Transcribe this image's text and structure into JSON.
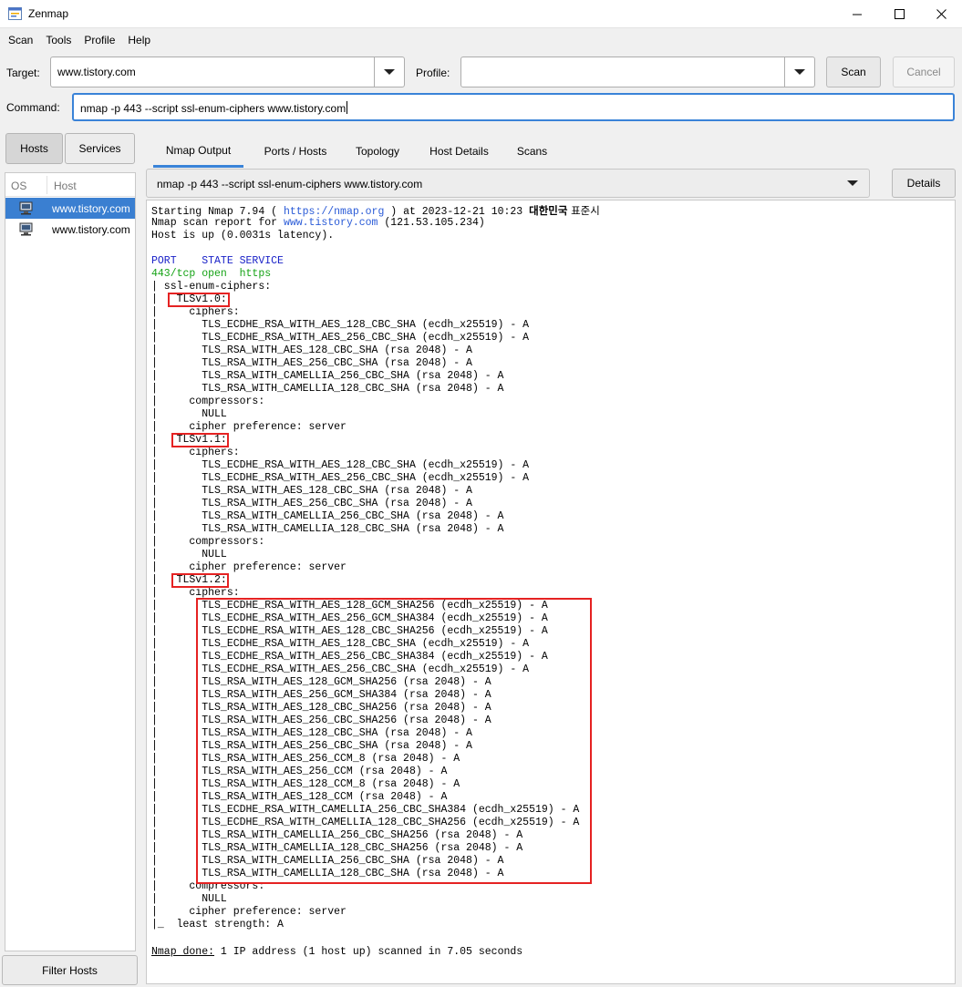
{
  "window": {
    "title": "Zenmap",
    "controls": {
      "minimize": "—",
      "maximize": "☐",
      "close": "✕"
    }
  },
  "menu": [
    "Scan",
    "Tools",
    "Profile",
    "Help"
  ],
  "toolbar": {
    "target_label": "Target:",
    "target_value": "www.tistory.com",
    "profile_label": "Profile:",
    "profile_value": "",
    "scan_button": "Scan",
    "cancel_button": "Cancel",
    "command_label": "Command:",
    "command_value": "nmap -p 443 --script ssl-enum-ciphers www.tistory.com"
  },
  "sidebar": {
    "tabs": [
      "Hosts",
      "Services"
    ],
    "active_tab": "Hosts",
    "columns": [
      "OS",
      "Host"
    ],
    "hosts": [
      {
        "name": "www.tistory.com",
        "selected": true
      },
      {
        "name": "www.tistory.com",
        "selected": false
      }
    ],
    "filter_button": "Filter Hosts"
  },
  "main": {
    "tabs": [
      "Nmap Output",
      "Ports / Hosts",
      "Topology",
      "Host Details",
      "Scans"
    ],
    "active_tab": "Nmap Output",
    "scan_selector": "nmap -p 443 --script ssl-enum-ciphers www.tistory.com",
    "details_button": "Details"
  },
  "output": {
    "header": {
      "start_prefix": "Starting Nmap 7.94 ( ",
      "start_url": "https://nmap.org",
      "start_mid": " ) at ",
      "start_datetime": "2023-12-21 10:23",
      "start_tz_bold": "대한민국",
      "start_tz_rest": " 표준시",
      "report_prefix": "Nmap scan report for ",
      "report_host": "www.tistory.com",
      "report_ip": " (121.53.105.234)",
      "host_up": "Host is up (0.0031s latency)."
    },
    "port_header": "PORT    STATE SERVICE",
    "port_line": "443/tcp open  https",
    "script_lines": [
      "| ssl-enum-ciphers:",
      "|   TLSv1.0:",
      "|     ciphers:",
      "|       TLS_ECDHE_RSA_WITH_AES_128_CBC_SHA (ecdh_x25519) - A",
      "|       TLS_ECDHE_RSA_WITH_AES_256_CBC_SHA (ecdh_x25519) - A",
      "|       TLS_RSA_WITH_AES_128_CBC_SHA (rsa 2048) - A",
      "|       TLS_RSA_WITH_AES_256_CBC_SHA (rsa 2048) - A",
      "|       TLS_RSA_WITH_CAMELLIA_256_CBC_SHA (rsa 2048) - A",
      "|       TLS_RSA_WITH_CAMELLIA_128_CBC_SHA (rsa 2048) - A",
      "|     compressors:",
      "|       NULL",
      "|     cipher preference: server",
      "|   TLSv1.1:",
      "|     ciphers:",
      "|       TLS_ECDHE_RSA_WITH_AES_128_CBC_SHA (ecdh_x25519) - A",
      "|       TLS_ECDHE_RSA_WITH_AES_256_CBC_SHA (ecdh_x25519) - A",
      "|       TLS_RSA_WITH_AES_128_CBC_SHA (rsa 2048) - A",
      "|       TLS_RSA_WITH_AES_256_CBC_SHA (rsa 2048) - A",
      "|       TLS_RSA_WITH_CAMELLIA_256_CBC_SHA (rsa 2048) - A",
      "|       TLS_RSA_WITH_CAMELLIA_128_CBC_SHA (rsa 2048) - A",
      "|     compressors:",
      "|       NULL",
      "|     cipher preference: server",
      "|   TLSv1.2:",
      "|     ciphers:",
      "|       TLS_ECDHE_RSA_WITH_AES_128_GCM_SHA256 (ecdh_x25519) - A",
      "|       TLS_ECDHE_RSA_WITH_AES_256_GCM_SHA384 (ecdh_x25519) - A",
      "|       TLS_ECDHE_RSA_WITH_AES_128_CBC_SHA256 (ecdh_x25519) - A",
      "|       TLS_ECDHE_RSA_WITH_AES_128_CBC_SHA (ecdh_x25519) - A",
      "|       TLS_ECDHE_RSA_WITH_AES_256_CBC_SHA384 (ecdh_x25519) - A",
      "|       TLS_ECDHE_RSA_WITH_AES_256_CBC_SHA (ecdh_x25519) - A",
      "|       TLS_RSA_WITH_AES_128_GCM_SHA256 (rsa 2048) - A",
      "|       TLS_RSA_WITH_AES_256_GCM_SHA384 (rsa 2048) - A",
      "|       TLS_RSA_WITH_AES_128_CBC_SHA256 (rsa 2048) - A",
      "|       TLS_RSA_WITH_AES_256_CBC_SHA256 (rsa 2048) - A",
      "|       TLS_RSA_WITH_AES_128_CBC_SHA (rsa 2048) - A",
      "|       TLS_RSA_WITH_AES_256_CBC_SHA (rsa 2048) - A",
      "|       TLS_RSA_WITH_AES_256_CCM_8 (rsa 2048) - A",
      "|       TLS_RSA_WITH_AES_256_CCM (rsa 2048) - A",
      "|       TLS_RSA_WITH_AES_128_CCM_8 (rsa 2048) - A",
      "|       TLS_RSA_WITH_AES_128_CCM (rsa 2048) - A",
      "|       TLS_ECDHE_RSA_WITH_CAMELLIA_256_CBC_SHA384 (ecdh_x25519) - A",
      "|       TLS_ECDHE_RSA_WITH_CAMELLIA_128_CBC_SHA256 (ecdh_x25519) - A",
      "|       TLS_RSA_WITH_CAMELLIA_256_CBC_SHA256 (rsa 2048) - A",
      "|       TLS_RSA_WITH_CAMELLIA_128_CBC_SHA256 (rsa 2048) - A",
      "|       TLS_RSA_WITH_CAMELLIA_256_CBC_SHA (rsa 2048) - A",
      "|       TLS_RSA_WITH_CAMELLIA_128_CBC_SHA (rsa 2048) - A",
      "|     compressors:",
      "|       NULL",
      "|     cipher preference: server",
      "|_  least strength: A"
    ],
    "done_label": "Nmap done:",
    "done_text": " 1 IP address (1 host up) scanned in 7.05 seconds"
  },
  "colors": {
    "accent": "#3a83d8",
    "selection": "#3a7fd1",
    "highlight_box": "#e52222",
    "port_header": "#1a22c8",
    "open_port": "#16a316",
    "link": "#2a5bd7"
  }
}
